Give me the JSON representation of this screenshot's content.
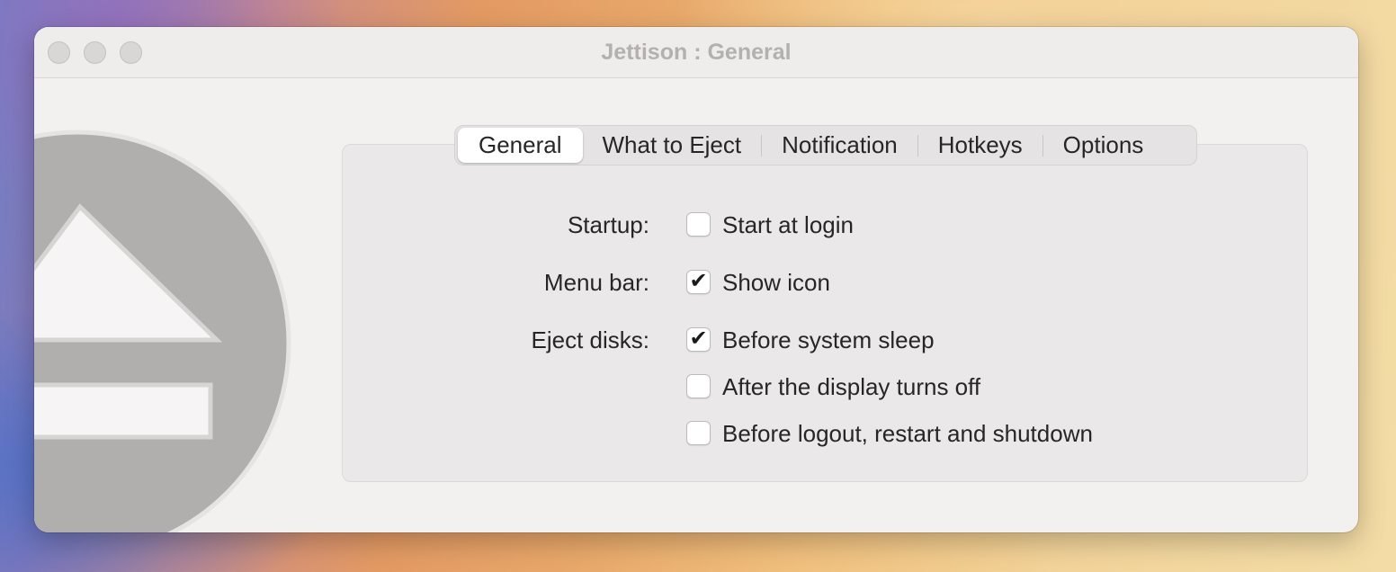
{
  "window": {
    "title": "Jettison : General"
  },
  "tabs": [
    {
      "label": "General",
      "active": true
    },
    {
      "label": "What to Eject",
      "active": false
    },
    {
      "label": "Notification",
      "active": false
    },
    {
      "label": "Hotkeys",
      "active": false
    },
    {
      "label": "Options",
      "active": false
    }
  ],
  "settings": {
    "startup_label": "Startup:",
    "menubar_label": "Menu bar:",
    "eject_label": "Eject disks:",
    "options": [
      {
        "label": "Start at login",
        "checked": false,
        "mark": ""
      },
      {
        "label": "Show icon",
        "checked": true,
        "mark": "✔"
      },
      {
        "label": "Before system sleep",
        "checked": true,
        "mark": "✔"
      },
      {
        "label": "After the display turns off",
        "checked": false,
        "mark": ""
      },
      {
        "label": "Before logout, restart and shutdown",
        "checked": false,
        "mark": ""
      }
    ]
  },
  "icons": {
    "app_icon": "eject-icon",
    "window_controls": [
      "close-button",
      "minimize-button",
      "zoom-button"
    ]
  },
  "colors": {
    "window_bg": "#f3f1f0",
    "panel_bg": "#eae8e8",
    "icon_gray": "#b0afae",
    "title_color": "#b3b1b0"
  }
}
